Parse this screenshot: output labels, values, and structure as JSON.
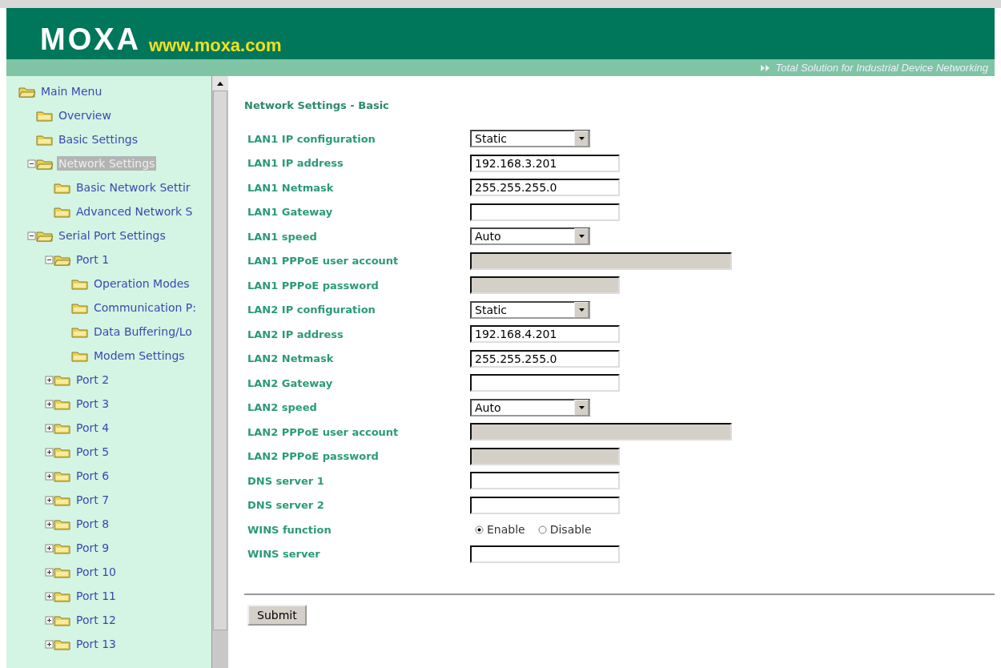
{
  "header": {
    "logo": "MOXA",
    "website": "www.moxa.com",
    "tagline": "Total Solution for Industrial Device Networking"
  },
  "sidebar": {
    "tree": [
      {
        "label": "Main Menu",
        "selected": false,
        "expanded": true,
        "children": [
          {
            "label": "Overview",
            "selected": false
          },
          {
            "label": "Basic Settings",
            "selected": false
          },
          {
            "label": "Network Settings",
            "selected": true,
            "expanded": true,
            "children": [
              {
                "label": "Basic Network Settir",
                "selected": false
              },
              {
                "label": "Advanced Network S",
                "selected": false
              }
            ]
          },
          {
            "label": "Serial Port Settings",
            "selected": false,
            "expanded": true,
            "children": [
              {
                "label": "Port 1",
                "selected": false,
                "expanded": true,
                "children": [
                  {
                    "label": "Operation Modes",
                    "selected": false
                  },
                  {
                    "label": "Communication P:",
                    "selected": false
                  },
                  {
                    "label": "Data Buffering/Lo",
                    "selected": false
                  },
                  {
                    "label": "Modem Settings",
                    "selected": false
                  }
                ]
              },
              {
                "label": "Port 2",
                "selected": false,
                "expanded": false
              },
              {
                "label": "Port 3",
                "selected": false,
                "expanded": false
              },
              {
                "label": "Port 4",
                "selected": false,
                "expanded": false
              },
              {
                "label": "Port 5",
                "selected": false,
                "expanded": false
              },
              {
                "label": "Port 6",
                "selected": false,
                "expanded": false
              },
              {
                "label": "Port 7",
                "selected": false,
                "expanded": false
              },
              {
                "label": "Port 8",
                "selected": false,
                "expanded": false
              },
              {
                "label": "Port 9",
                "selected": false,
                "expanded": false
              },
              {
                "label": "Port 10",
                "selected": false,
                "expanded": false
              },
              {
                "label": "Port 11",
                "selected": false,
                "expanded": false
              },
              {
                "label": "Port 12",
                "selected": false,
                "expanded": false
              },
              {
                "label": "Port 13",
                "selected": false,
                "expanded": false
              }
            ]
          }
        ]
      }
    ]
  },
  "form": {
    "title": "Network Settings - Basic",
    "fields": [
      {
        "label": "LAN1 IP configuration",
        "kind": "select",
        "value": "Static"
      },
      {
        "label": "LAN1 IP address",
        "kind": "text",
        "value": "192.168.3.201",
        "disabled": false
      },
      {
        "label": "LAN1 Netmask",
        "kind": "text",
        "value": "255.255.255.0",
        "disabled": false
      },
      {
        "label": "LAN1 Gateway",
        "kind": "text",
        "disabled": false
      },
      {
        "label": "LAN1 speed",
        "kind": "select",
        "value": "Auto"
      },
      {
        "label": "LAN1 PPPoE user account",
        "kind": "wide",
        "disabled": true
      },
      {
        "label": "LAN1 PPPoE password",
        "kind": "text",
        "disabled": true
      },
      {
        "label": "LAN2 IP configuration",
        "kind": "select",
        "value": "Static"
      },
      {
        "label": "LAN2 IP address",
        "kind": "text",
        "value": "192.168.4.201",
        "disabled": false
      },
      {
        "label": "LAN2 Netmask",
        "kind": "text",
        "value": "255.255.255.0",
        "disabled": false
      },
      {
        "label": "LAN2 Gateway",
        "kind": "text",
        "disabled": false
      },
      {
        "label": "LAN2 speed",
        "kind": "select",
        "value": "Auto"
      },
      {
        "label": "LAN2 PPPoE user account",
        "kind": "wide",
        "disabled": true
      },
      {
        "label": "LAN2 PPPoE password",
        "kind": "text",
        "disabled": true
      },
      {
        "label": "DNS server 1",
        "kind": "text",
        "disabled": false
      },
      {
        "label": "DNS server 2",
        "kind": "text",
        "disabled": false
      },
      {
        "label": "WINS function",
        "kind": "radio",
        "options": [
          {
            "label": "Enable",
            "selected": true
          },
          {
            "label": "Disable",
            "selected": false
          }
        ]
      },
      {
        "label": "WINS server",
        "kind": "text",
        "disabled": false
      }
    ],
    "submit": "Submit"
  }
}
